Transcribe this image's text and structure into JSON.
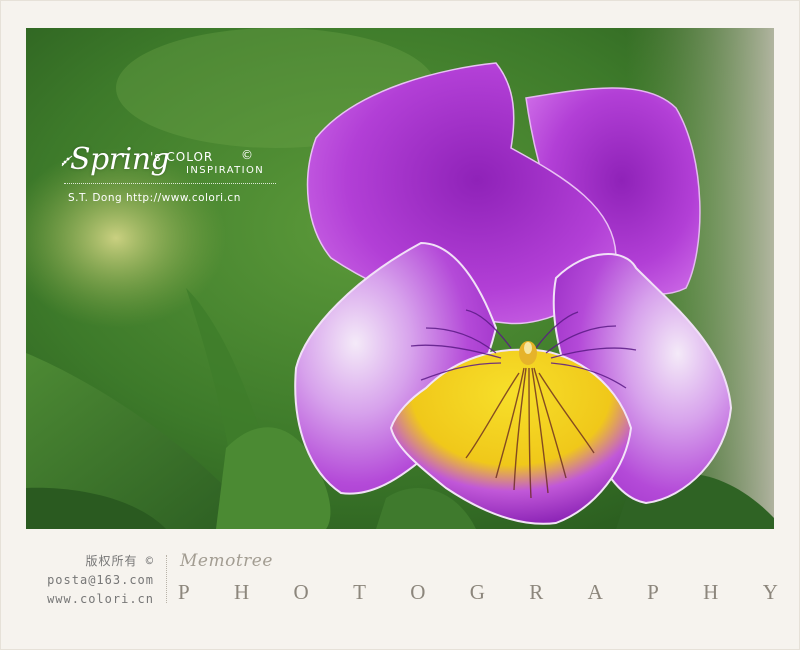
{
  "watermark": {
    "script_title": "Spring",
    "possessive": "'s COLOR",
    "copyright_symbol": "©",
    "subtitle": "INSPIRATION",
    "credit": "S.T. Dong  http://www.colori.cn"
  },
  "footer": {
    "rights": "版权所有 ©",
    "email": "posta@163.com",
    "website": "www.colori.cn",
    "brand_name": "Memotree",
    "brand_tagline": "PHOTOGRAPHY"
  },
  "colors": {
    "petal_purple": "#b23fd6",
    "petal_center": "#f2d21c",
    "background_green": "#3f7a2e",
    "frame": "#f6f3ee"
  }
}
